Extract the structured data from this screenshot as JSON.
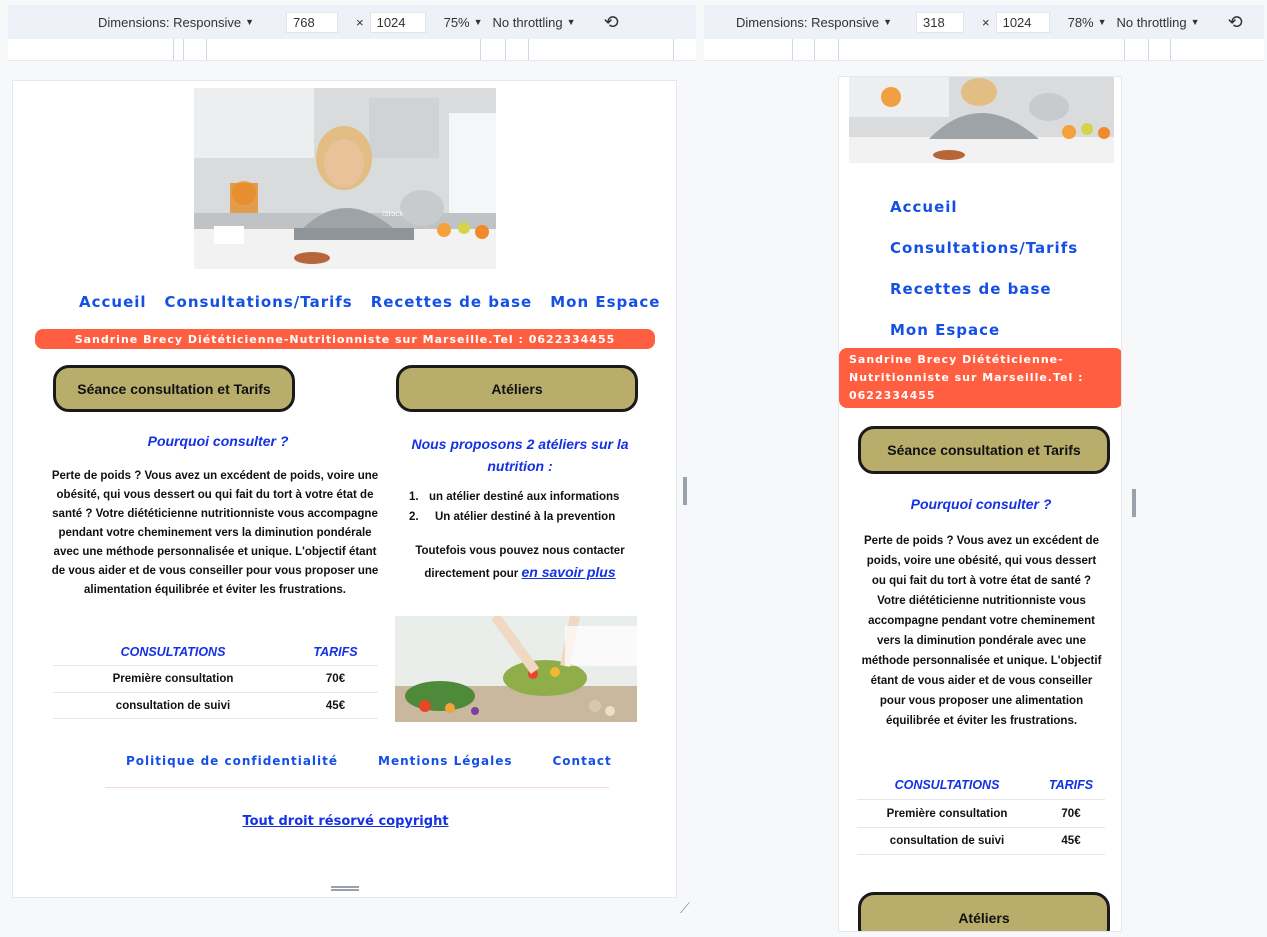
{
  "devtools_left": {
    "dimensions_label": "Dimensions: Responsive",
    "width": "768",
    "times": "×",
    "height": "1024",
    "zoom": "75%",
    "throttle": "No throttling"
  },
  "devtools_right": {
    "dimensions_label": "Dimensions: Responsive",
    "width": "318",
    "times": "×",
    "height": "1024",
    "zoom": "78%",
    "throttle": "No throttling"
  },
  "site": {
    "hero_watermark": "iStock",
    "nav": [
      "Accueil",
      "Consultations/Tarifs",
      "Recettes de base",
      "Mon Espace"
    ],
    "banner": "Sandrine Brecy Diététicienne-Nutritionniste sur Marseille.Tel : 0622334455",
    "section1_button": "Séance consultation et Tarifs",
    "section2_button": "Atéliers",
    "why_title": "Pourquoi consulter ?",
    "why_text": "Perte de poids ? Vous avez un excédent de poids, voire une obésité, qui vous dessert ou qui fait du tort à votre état de santé ? Votre diététicienne nutritionniste vous accompagne pendant votre cheminement vers la diminution pondérale avec une méthode personnalisée et unique. L'objectif étant de vous aider et de vous conseiller pour vous proposer une alimentation équilibrée et éviter les frustrations.",
    "table": {
      "headers": [
        "CONSULTATIONS",
        "TARIFS"
      ],
      "rows": [
        [
          "Première consultation",
          "70€"
        ],
        [
          "consultation de suivi",
          "45€"
        ]
      ]
    },
    "ateliers_title": "Nous proposons 2 atéliers sur la nutrition :",
    "ateliers_list": [
      {
        "n": "1.",
        "text": "un atélier destiné aux informations"
      },
      {
        "n": "2.",
        "text": "Un atélier destiné à la prevention"
      }
    ],
    "contact_text": "Toutefois vous pouvez nous contacter directement pour",
    "contact_link": "en savoir plus",
    "footer_nav": [
      "Politique de confidentialité",
      "Mentions Légales",
      "Contact"
    ],
    "copyright": "Tout droit résorvé copyright"
  },
  "colors": {
    "link_blue": "#1550e6",
    "banner_red": "#ff5e41",
    "button_olive": "#b8ad6b",
    "title_blue": "#1431e3"
  }
}
